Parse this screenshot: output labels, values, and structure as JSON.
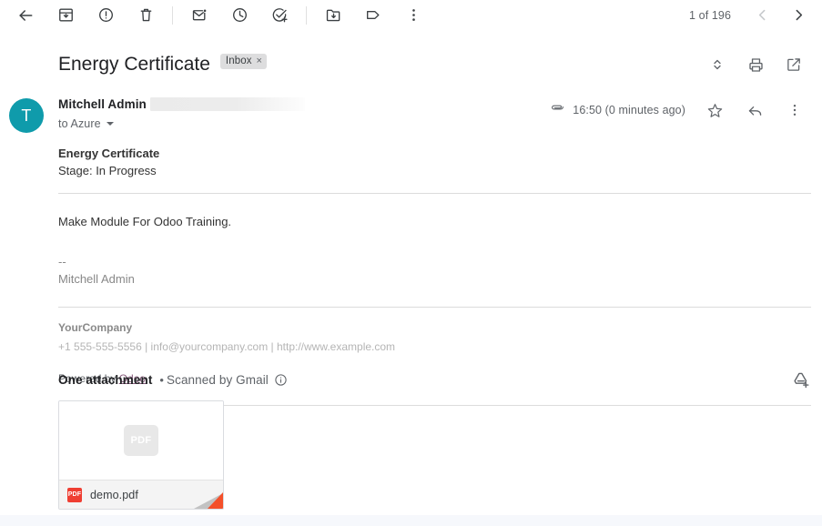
{
  "toolbar": {
    "back_label": "Back to Inbox",
    "actions": [
      {
        "name": "archive-button",
        "label": "Archive"
      },
      {
        "name": "report-spam-button",
        "label": "Report spam"
      },
      {
        "name": "delete-button",
        "label": "Delete"
      },
      {
        "name": "mark-unread-button",
        "label": "Mark as unread"
      },
      {
        "name": "snooze-button",
        "label": "Snooze"
      },
      {
        "name": "add-to-tasks-button",
        "label": "Add to tasks"
      },
      {
        "name": "move-to-button",
        "label": "Move to"
      },
      {
        "name": "labels-button",
        "label": "Labels"
      },
      {
        "name": "more-options-button",
        "label": "More"
      }
    ],
    "counter": "1 of 196",
    "prev_label": "Older",
    "next_label": "Newer"
  },
  "subject": {
    "title": "Energy Certificate",
    "label_chip": "Inbox",
    "label_chip_remove": "×",
    "actions": [
      {
        "name": "expand-all-button",
        "label": "Expand all"
      },
      {
        "name": "print-button",
        "label": "Print all"
      },
      {
        "name": "open-in-new-window-button",
        "label": "In new window"
      }
    ]
  },
  "message": {
    "avatar_initial": "T",
    "avatar_color": "#0f9bab",
    "sender_name": "Mitchell Admin",
    "sender_email_redacted": true,
    "recipient": "to Azure",
    "timestamp": "16:50 (0 minutes ago)",
    "has_attachment_icon": true,
    "star_label": "Not starred",
    "reply_label": "Reply",
    "more_label": "More"
  },
  "body": {
    "heading": "Energy Certificate",
    "stage": "Stage: In Progress",
    "paragraph": "Make Module For Odoo Training.",
    "signature_separator": "--",
    "signature_name": "Mitchell Admin",
    "footer_company": "YourCompany",
    "footer_contact": "+1 555-555-5556 | info@yourcompany.com | http://www.example.com",
    "powered_by_prefix": "Powered by ",
    "powered_by_link": "Odoo",
    "powered_by_link_color": "#875a7b"
  },
  "attachments": {
    "count_label": "One attachment",
    "separator": "•",
    "scanned_label": "Scanned by Gmail",
    "info_label": "Learn more",
    "save_all_to_drive_label": "Save all to Drive",
    "items": [
      {
        "filename": "demo.pdf",
        "type_badge": "PDF",
        "preview_text": "PDF",
        "badge_color": "#ef3e32"
      }
    ]
  }
}
